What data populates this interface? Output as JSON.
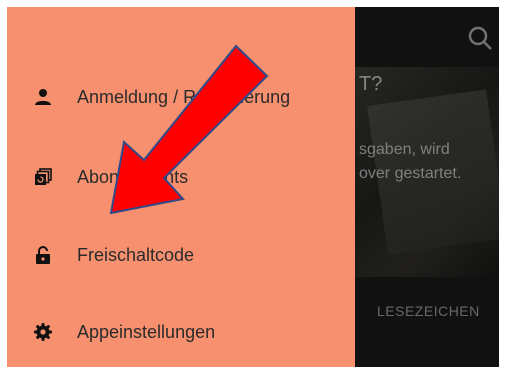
{
  "background": {
    "title": "T?",
    "line1": "sgaben, wird",
    "line2": "over gestartet.",
    "button_label": "LESEZEICHEN",
    "search_icon": "search-icon"
  },
  "drawer": {
    "items": [
      {
        "label": "Anmeldung / Registrierung",
        "icon": "person-icon"
      },
      {
        "label": "Abonnements",
        "icon": "subscriptions-icon"
      },
      {
        "label": "Freischaltcode",
        "icon": "lock-open-icon"
      },
      {
        "label": "Appeinstellungen",
        "icon": "gear-icon"
      }
    ]
  },
  "colors": {
    "drawer_bg": "#f6906f",
    "arrow_fill": "#ff0000",
    "arrow_stroke": "#2e4a8a"
  }
}
